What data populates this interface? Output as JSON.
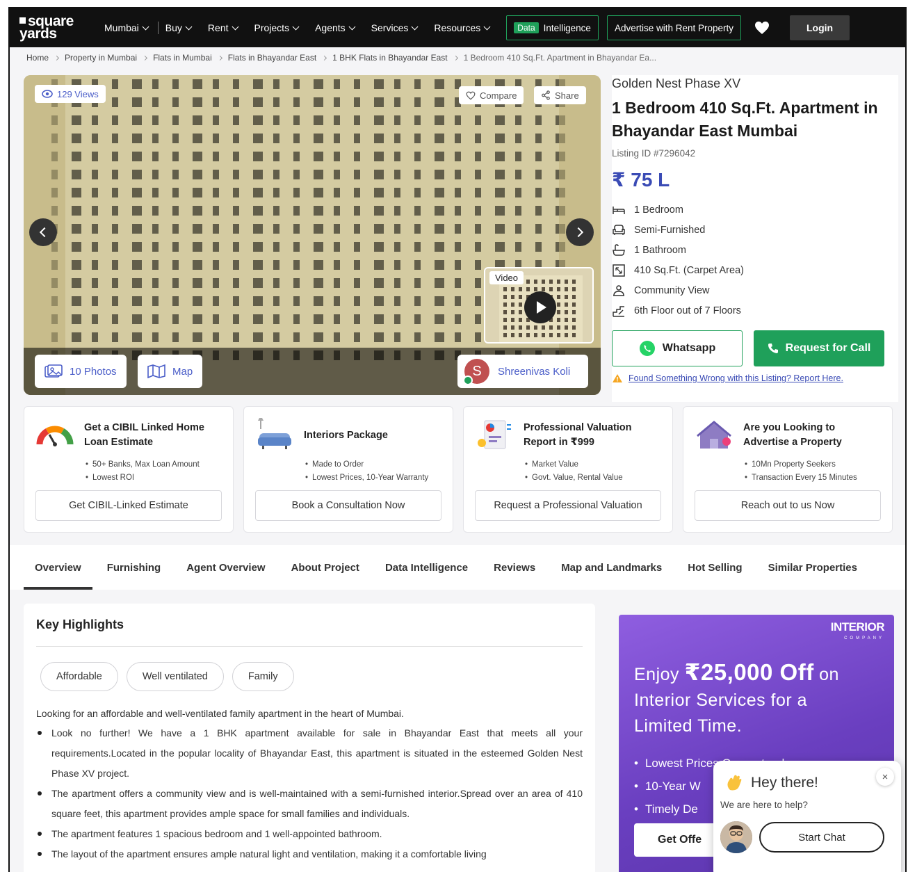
{
  "header": {
    "logo_line1": "square",
    "logo_line2": "yards",
    "city": "Mumbai",
    "nav": [
      "Buy",
      "Rent",
      "Projects",
      "Agents",
      "Services",
      "Resources"
    ],
    "data_tag": "Data",
    "data_intel": "Intelligence",
    "advertise": "Advertise with Rent Property",
    "login": "Login"
  },
  "breadcrumb": [
    "Home",
    "Property in Mumbai",
    "Flats in Mumbai",
    "Flats in Bhayandar East",
    "1 BHK Flats in Bhayandar East",
    "1 Bedroom 410 Sq.Ft. Apartment in Bhayandar Ea..."
  ],
  "gallery": {
    "views": "129 Views",
    "compare": "Compare",
    "share": "Share",
    "video": "Video",
    "photos": "10 Photos",
    "map": "Map",
    "agent_initial": "S",
    "agent_name": "Shreenivas Koli"
  },
  "property": {
    "project": "Golden Nest Phase XV",
    "title": "1 Bedroom 410 Sq.Ft. Apartment in Bhayandar East Mumbai",
    "listing_id": "Listing ID #7296042",
    "price": "₹ 75 L",
    "features": [
      {
        "icon": "bed-icon",
        "text": "1 Bedroom"
      },
      {
        "icon": "sofa-icon",
        "text": "Semi-Furnished"
      },
      {
        "icon": "bathtub-icon",
        "text": "1 Bathroom"
      },
      {
        "icon": "area-icon",
        "text": "410 Sq.Ft. (Carpet Area)"
      },
      {
        "icon": "community-icon",
        "text": "Community View"
      },
      {
        "icon": "floor-icon",
        "text": "6th Floor out of 7 Floors"
      }
    ],
    "whatsapp": "Whatsapp",
    "request_call": "Request for Call",
    "report": "Found Something Wrong with this Listing? Report Here."
  },
  "cards": [
    {
      "title": "Get a CIBIL Linked Home Loan Estimate",
      "points": [
        "50+ Banks, Max Loan Amount",
        "Lowest ROI"
      ],
      "button": "Get CIBIL-Linked Estimate"
    },
    {
      "title": "Interiors Package",
      "points": [
        "Made to Order",
        "Lowest Prices, 10-Year Warranty"
      ],
      "button": "Book a Consultation Now"
    },
    {
      "title": "Professional Valuation Report in ₹999",
      "points": [
        "Market Value",
        "Govt. Value, Rental Value"
      ],
      "button": "Request a Professional Valuation"
    },
    {
      "title": "Are you Looking to Advertise a Property",
      "points": [
        "10Mn Property Seekers",
        "Transaction Every 15 Minutes"
      ],
      "button": "Reach out to us Now"
    }
  ],
  "tabs": [
    "Overview",
    "Furnishing",
    "Agent Overview",
    "About Project",
    "Data Intelligence",
    "Reviews",
    "Map and Landmarks",
    "Hot Selling",
    "Similar Properties"
  ],
  "highlights": {
    "title": "Key Highlights",
    "chips": [
      "Affordable",
      "Well ventilated",
      "Family"
    ],
    "intro": "Looking for an affordable and well-ventilated family apartment in the heart of Mumbai.",
    "points": [
      "Look no further! We have a 1 BHK apartment available for sale in Bhayandar East that meets all your requirements.Located in the popular locality of Bhayandar East, this apartment is situated in the esteemed Golden Nest Phase XV project.",
      "The apartment offers a community view and is well-maintained with a semi-furnished interior.Spread over an area of 410 square feet, this apartment provides ample space for small families and individuals.",
      "The apartment features 1 spacious bedroom and 1 well-appointed bathroom.",
      "The layout of the apartment ensures ample natural light and ventilation, making it a comfortable living"
    ]
  },
  "promo": {
    "brand": "INTERIOR",
    "brand_sub": "COMPANY",
    "line1_pre": "Enjoy ",
    "amount": "₹25,000 Off",
    "line1_post": " on",
    "line2": "Interior Services for a",
    "line3": "Limited Time.",
    "points": [
      "Lowest Prices Guaranteed",
      "10-Year W",
      "Timely De"
    ],
    "button": "Get Offe"
  },
  "chat": {
    "greeting": "Hey there!",
    "sub": "We are here to help?",
    "start": "Start Chat",
    "close": "×"
  }
}
